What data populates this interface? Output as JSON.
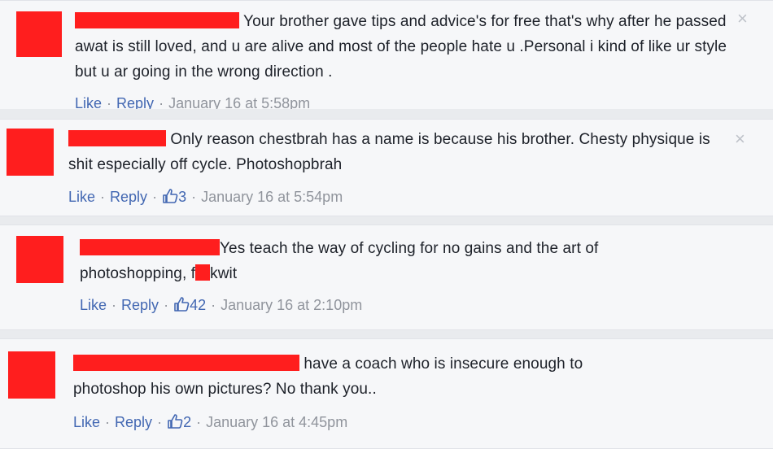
{
  "comments": [
    {
      "text": "Your brother gave tips and advice's for free that's why after he passed awat is still loved, and u are alive and most of the people hate u .Personal i kind of like ur style but u ar going in the wrong direction .",
      "like": "Like",
      "reply": "Reply",
      "likes": "",
      "date": "January 16 at 5:58pm"
    },
    {
      "text": "Only reason chestbrah has a name is because his brother. Chesty physique is shit especially off cycle. Photoshopbrah",
      "like": "Like",
      "reply": "Reply",
      "likes": "3",
      "date": "January 16 at 5:54pm"
    },
    {
      "text_before": "Yes teach the way of cycling for no gains and the art of photoshopping, f",
      "text_after": "kwit",
      "like": "Like",
      "reply": "Reply",
      "likes": "42",
      "date": "January 16 at 2:10pm"
    },
    {
      "text": "have a coach who is insecure enough to photoshop his own pictures? No thank you..",
      "like": "Like",
      "reply": "Reply",
      "likes": "2",
      "date": "January 16 at 4:45pm"
    }
  ],
  "close_glyph": "×",
  "colors": {
    "redaction": "#ff1e1e",
    "link": "#4267b2",
    "muted": "#90949c",
    "background": "#e9ebee",
    "panel": "#f6f7f9"
  }
}
